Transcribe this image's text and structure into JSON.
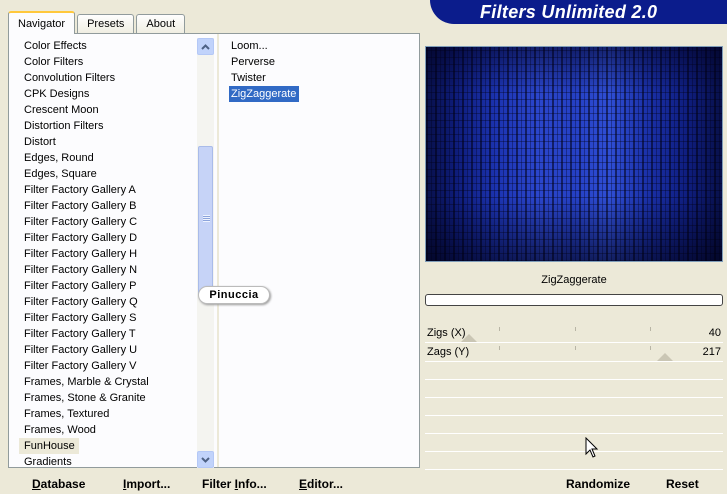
{
  "tabs": [
    {
      "label": "Navigator",
      "active": true
    },
    {
      "label": "Presets",
      "active": false
    },
    {
      "label": "About",
      "active": false
    }
  ],
  "app_title": "Filters Unlimited 2.0",
  "categories": [
    "Color Effects",
    "Color Filters",
    "Convolution Filters",
    "CPK Designs",
    "Crescent Moon",
    "Distortion Filters",
    "Distort",
    "Edges, Round",
    "Edges, Square",
    "Filter Factory Gallery A",
    "Filter Factory Gallery B",
    "Filter Factory Gallery C",
    "Filter Factory Gallery D",
    "Filter Factory Gallery H",
    "Filter Factory Gallery N",
    "Filter Factory Gallery P",
    "Filter Factory Gallery Q",
    "Filter Factory Gallery S",
    "Filter Factory Gallery T",
    "Filter Factory Gallery U",
    "Filter Factory Gallery V",
    "Frames, Marble & Crystal",
    "Frames, Stone & Granite",
    "Frames, Textured",
    "Frames, Wood",
    "FunHouse",
    "Gradients"
  ],
  "selected_category": "FunHouse",
  "filters": [
    "Loom...",
    "Perverse",
    "Twister",
    "ZigZaggerate"
  ],
  "selected_filter": "ZigZaggerate",
  "watermark": "Pinuccia",
  "current_filter_name": "ZigZaggerate",
  "params": [
    {
      "label": "Zigs (X)",
      "value": "40",
      "level": 40
    },
    {
      "label": "Zags (Y)",
      "value": "217",
      "level": 217
    }
  ],
  "buttons": {
    "database": {
      "label": "Database",
      "ul": "D"
    },
    "import": {
      "label": "Import...",
      "ul": "I"
    },
    "filter_info": {
      "label": "Filter Info...",
      "ul": "I"
    },
    "editor": {
      "label": "Editor...",
      "ul": "E"
    },
    "randomize": "Randomize",
    "reset": "Reset"
  },
  "colors": {
    "selection": "#316ac5",
    "banner": "#0b1c8c",
    "preview_blue": "#2b46cc"
  }
}
